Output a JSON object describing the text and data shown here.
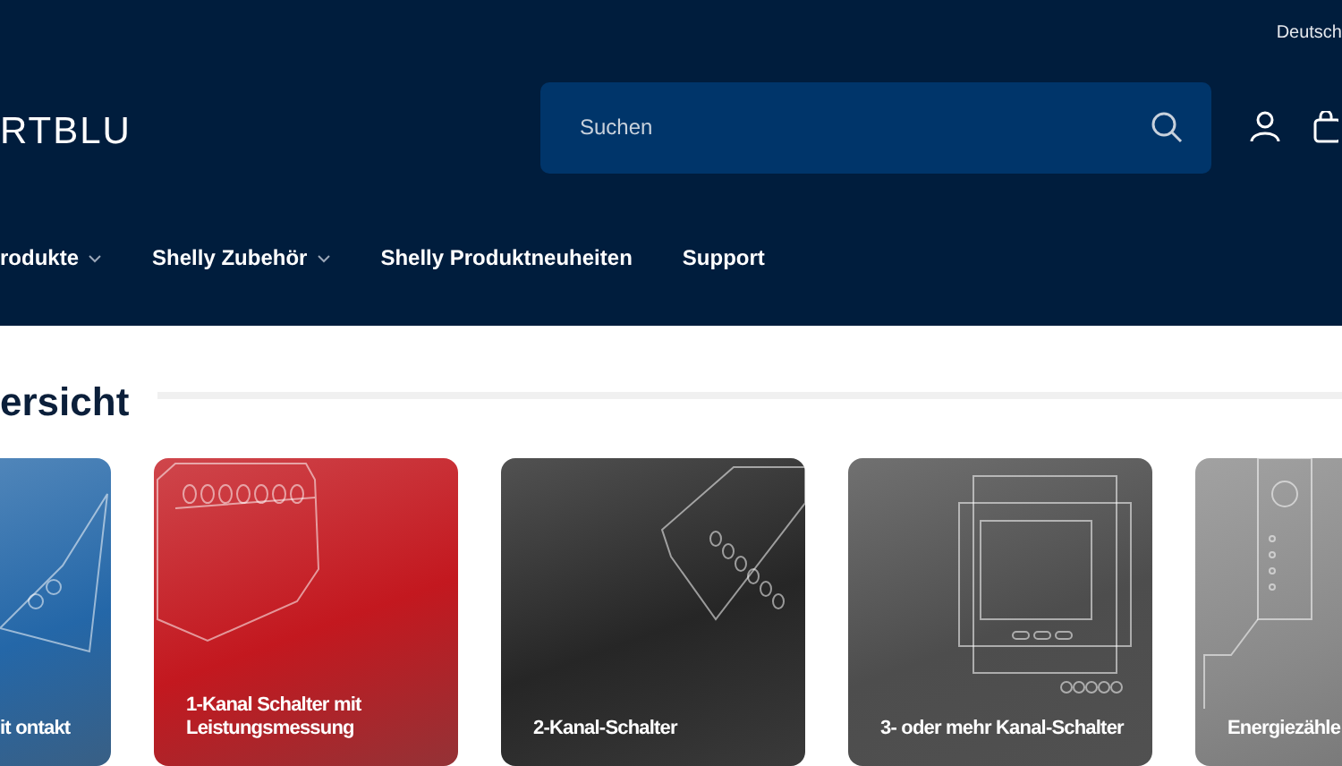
{
  "top_bar": {
    "language": "Deutsch"
  },
  "header": {
    "logo": "RTBLU",
    "search": {
      "placeholder": "Suchen"
    }
  },
  "nav": [
    {
      "label": "rodukte",
      "dropdown": true
    },
    {
      "label": "Shelly Zubehör",
      "dropdown": true
    },
    {
      "label": "Shelly Produktneuheiten",
      "dropdown": false
    },
    {
      "label": "Support",
      "dropdown": false
    }
  ],
  "section": {
    "title": "ersicht"
  },
  "cards": [
    {
      "label": "it ontakt",
      "color": "#2467a8",
      "kind": "plug"
    },
    {
      "label": "1-Kanal Schalter mit Leistungsmessung",
      "color": "#c3181f",
      "kind": "relay"
    },
    {
      "label": "2-Kanal-Schalter",
      "color": "#262626",
      "kind": "angled"
    },
    {
      "label": "3- oder mehr Kanal-Schalter",
      "color": "#4d4d4d",
      "kind": "din"
    },
    {
      "label": "Energiezähle",
      "color": "#8a8a8a",
      "kind": "meter"
    }
  ]
}
